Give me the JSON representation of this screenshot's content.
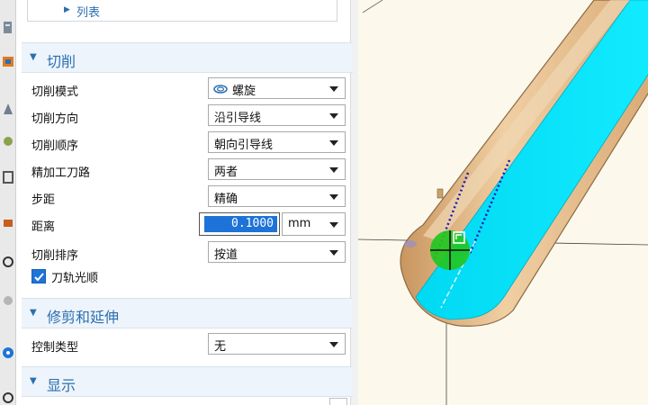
{
  "list_section": {
    "label": "列表"
  },
  "cut_section": {
    "title": "切削",
    "rows": [
      {
        "label": "切削模式",
        "value": "螺旋"
      },
      {
        "label": "切削方向",
        "value": "沿引导线"
      },
      {
        "label": "切削顺序",
        "value": "朝向引导线"
      },
      {
        "label": "精加工刀路",
        "value": "两者"
      },
      {
        "label": "步距",
        "value": "精确"
      }
    ],
    "distance": {
      "label": "距离",
      "value": "0.1000",
      "unit": "mm"
    },
    "sort": {
      "label": "切削排序",
      "value": "按道"
    },
    "smooth": {
      "label": "刀轨光顺",
      "checked": true
    }
  },
  "trim_section": {
    "title": "修剪和延伸",
    "control_type": {
      "label": "控制类型",
      "value": "无"
    }
  },
  "display_section": {
    "title": "显示"
  },
  "colors": {
    "accent": "#2a6fb0",
    "selection": "#1e73d8",
    "part_face": "#00e4f8",
    "part_shell": "#e9c191",
    "tool": "#22c522"
  }
}
